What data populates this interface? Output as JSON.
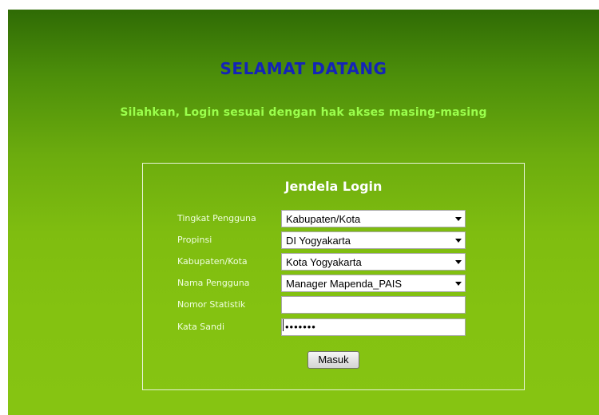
{
  "header": {
    "welcome": "SELAMAT DATANG",
    "subtitle": "Silahkan, Login sesuai dengan hak akses masing-masing"
  },
  "login": {
    "title": "Jendela Login",
    "fields": {
      "tingkat": {
        "label": "Tingkat Pengguna",
        "value": "Kabupaten/Kota"
      },
      "propinsi": {
        "label": "Propinsi",
        "value": "DI Yogyakarta"
      },
      "kabupaten": {
        "label": "Kabupaten/Kota",
        "value": "Kota Yogyakarta"
      },
      "pengguna": {
        "label": "Nama Pengguna",
        "value": "Manager Mapenda_PAIS"
      },
      "nomor": {
        "label": "Nomor Statistik",
        "value": ""
      },
      "sandi": {
        "label": "Kata Sandi",
        "value": "•••••••"
      }
    },
    "submit_label": "Masuk"
  },
  "colors": {
    "welcome": "#1424b8",
    "subtitle": "#9bff4c",
    "background_top": "#2f6b05",
    "background_bottom": "#86c412"
  }
}
